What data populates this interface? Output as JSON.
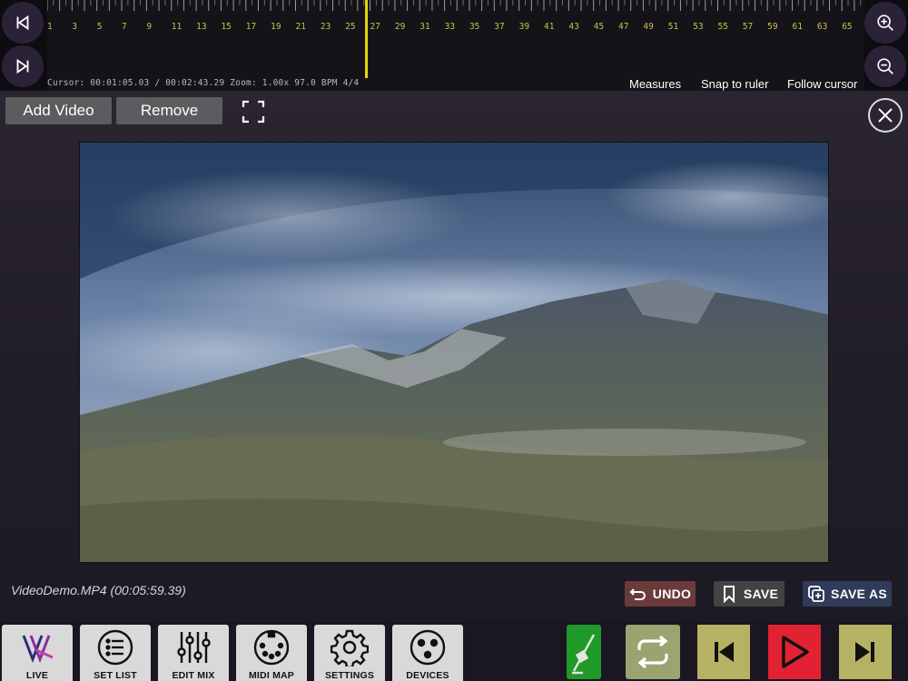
{
  "timeline": {
    "ruler_ticks": [
      "1",
      "3",
      "5",
      "7",
      "9",
      "11",
      "13",
      "15",
      "17",
      "19",
      "21",
      "23",
      "25",
      "27",
      "29",
      "31",
      "33",
      "35",
      "37",
      "39",
      "41",
      "43",
      "45",
      "47",
      "49",
      "51",
      "53",
      "55",
      "57",
      "59",
      "61",
      "63",
      "65"
    ],
    "playhead_measure": 27,
    "status": "Cursor: 00:01:05.03 / 00:02:43.29 Zoom: 1.00x 97.0 BPM 4/4",
    "options": {
      "measures": "Measures",
      "snap": "Snap to ruler",
      "follow": "Follow cursor"
    },
    "icons": {
      "prev": "skip-back-icon",
      "next": "skip-forward-icon",
      "zoom_in": "zoom-in-icon",
      "zoom_out": "zoom-out-icon"
    },
    "colors": {
      "tick": "#c8c04a",
      "playhead": "#e8d80c"
    }
  },
  "toolbar": {
    "add_video": "Add Video",
    "remove": "Remove"
  },
  "video": {
    "filename": "VideoDemo.MP4 (00:05:59.39)"
  },
  "actions": {
    "undo": "UNDO",
    "save": "SAVE",
    "save_as": "SAVE AS",
    "colors": {
      "undo": "#6b3b3b",
      "save": "#434343",
      "save_as": "#2f3b58"
    }
  },
  "nav": {
    "items": [
      {
        "label": "LIVE",
        "icon": "logo-icon"
      },
      {
        "label": "SET LIST",
        "icon": "list-icon"
      },
      {
        "label": "EDIT MIX",
        "icon": "sliders-icon"
      },
      {
        "label": "MIDI MAP",
        "icon": "midi-icon"
      },
      {
        "label": "SETTINGS",
        "icon": "gear-icon"
      },
      {
        "label": "DEVICES",
        "icon": "xlr-icon"
      }
    ]
  },
  "transport": {
    "colors": {
      "metronome": "#1f9a28",
      "loop": "#9aa470",
      "prev": "#b6b263",
      "play": "#e22232",
      "next": "#b6b263"
    }
  }
}
